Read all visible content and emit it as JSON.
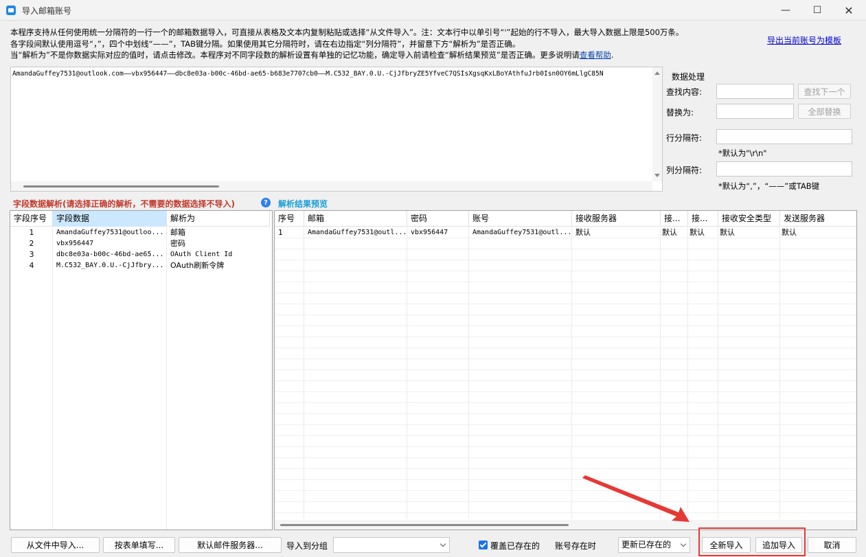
{
  "window": {
    "title": "导入邮箱账号",
    "minimize": "—",
    "maximize": "☐",
    "close": "✕"
  },
  "description": {
    "line1": "本程序支持从任何使用统一分隔符的一行一个的邮箱数据导入，可直接从表格及文本内复制粘贴或选择“从文件导入”。注：文本行中以单引号“'”起始的行不导入，最大导入数据上限是500万条。",
    "line2": "各字段间默认使用逗号“，”，四个中划线“——”，TAB键分隔。如果使用其它分隔符时，请在右边指定“列分隔符”，并留意下方“解析为”是否正确。",
    "line3": "当“解析为”不是你数据实际对应的值时，请点击修改。本程序对不同字段数的解析设置有单独的记忆功能，确定导入前请检查“解析结果预览”是否正确。更多说明请",
    "help_link": "查看帮助",
    "line3_end": "."
  },
  "export_link": "导出当前账号为模板",
  "input_text": "AmandaGuffey7531@outlook.com——vbx956447——dbc8e03a-b00c-46bd-ae65-b683e7707cb0——M.C532_BAY.0.U.-CjJfbryZE5YfveC7QSIsXgsqKxLBoYAthfuJrb0Isn0OY6mLlgC85N",
  "data_processing": {
    "title": "数据处理",
    "find_label": "查找内容:",
    "find_value": "",
    "find_next": "查找下一个",
    "replace_label": "替换为:",
    "replace_value": "",
    "replace_all": "全部替换",
    "row_sep_label": "行分隔符:",
    "row_sep_value": "",
    "row_sep_note": "*默认为\"\\r\\n\"",
    "col_sep_label": "列分隔符:",
    "col_sep_value": "",
    "col_sep_note": "*默认为“,”，“——”或TAB键"
  },
  "field_section_title": "字段数据解析(请选择正确的解析，不需要的数据选择不导入)",
  "preview_section_title": "解析结果预览",
  "field_table": {
    "headers": [
      "字段序号",
      "字段数据",
      "解析为"
    ],
    "rows": [
      [
        "1",
        "AmandaGuffey7531@outloo...",
        "邮箱"
      ],
      [
        "2",
        "vbx956447",
        "密码"
      ],
      [
        "3",
        "dbc8e03a-b00c-46bd-ae65...",
        "OAuth Client Id"
      ],
      [
        "4",
        "M.C532_BAY.0.U.-CjJfbry...",
        "OAuth刷新令牌"
      ]
    ]
  },
  "preview_table": {
    "headers": [
      "序号",
      "邮箱",
      "密码",
      "账号",
      "接收服务器",
      "接...",
      "接...",
      "接收安全类型",
      "发送服务器"
    ],
    "rows": [
      [
        "1",
        "AmandaGuffey7531@outl...",
        "vbx956447",
        "AmandaGuffey7531@outl...",
        "默认",
        "默认",
        "默认",
        "默认",
        "默认"
      ]
    ]
  },
  "bottom": {
    "import_file": "从文件中导入...",
    "fill_form": "按表单填写...",
    "default_server": "默认邮件服务器...",
    "group_label": "导入到分组",
    "group_value": "",
    "overwrite_label": "覆盖已存在的",
    "exists_label": "账号存在时",
    "exists_value": "更新已存在的",
    "new_import": "全新导入",
    "append_import": "追加导入",
    "cancel": "取消"
  }
}
